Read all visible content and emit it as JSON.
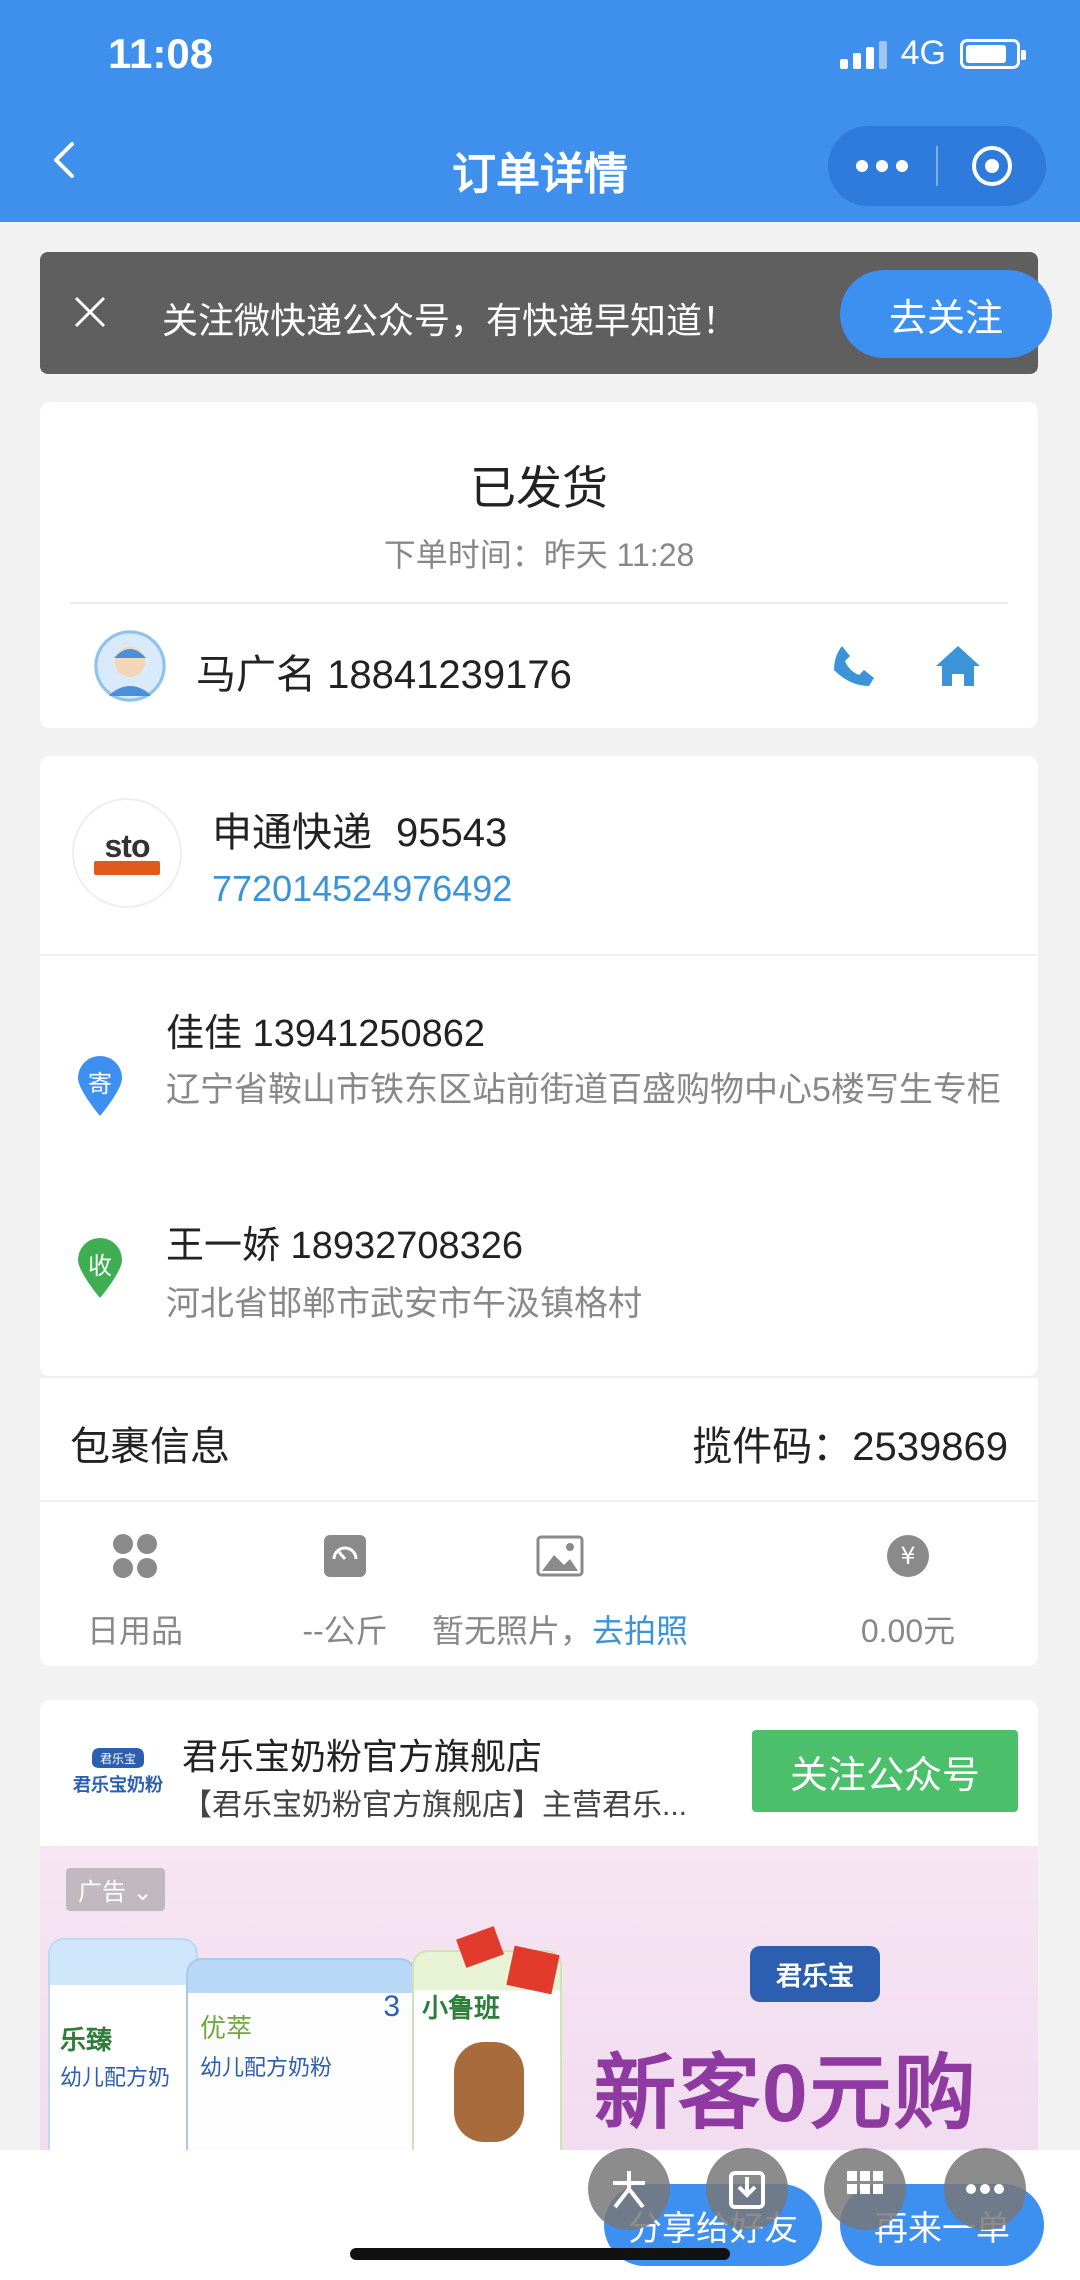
{
  "status_bar": {
    "time": "11:08",
    "network": "4G"
  },
  "nav": {
    "title": "订单详情"
  },
  "banner": {
    "text": "关注微快递公众号，有快递早知道！",
    "follow_label": "去关注"
  },
  "order": {
    "state": "已发货",
    "time_label": "下单时间：昨天 11:28",
    "contact": "马广名 18841239176"
  },
  "express": {
    "logo_text": "sto",
    "company": "申通快递",
    "hotline": "95543",
    "tracking_no": "772014524976492",
    "sender": {
      "badge": "寄",
      "name_phone": "佳佳 13941250862",
      "address": "辽宁省鞍山市铁东区站前街道百盛购物中心5楼写生专柜"
    },
    "receiver": {
      "badge": "收",
      "name_phone": "王一娇 18932708326",
      "address": "河北省邯郸市武安市午汲镇格村"
    }
  },
  "package": {
    "title": "包裹信息",
    "pickup_code": "揽件码：2539869",
    "items": {
      "category": "日用品",
      "weight": "--公斤",
      "photo_text": "暂无照片，",
      "photo_link": "去拍照",
      "price": "0.00元"
    }
  },
  "shop": {
    "logo_text": "君乐宝奶粉",
    "name": "君乐宝奶粉官方旗舰店",
    "desc": "【君乐宝奶粉官方旗舰店】主营君乐...",
    "follow_label": "关注公众号"
  },
  "ad": {
    "tag": "广告",
    "brand": "君乐宝",
    "slogan": "新客0元购"
  },
  "bottom": {
    "share_label": "分享给好友",
    "reorder_label": "再来一单"
  },
  "colors": {
    "primary": "#3f8fec",
    "link": "#3b93d8",
    "green": "#4cbf6b",
    "sender_pin": "#3d8ff0",
    "receiver_pin": "#3fae52"
  }
}
